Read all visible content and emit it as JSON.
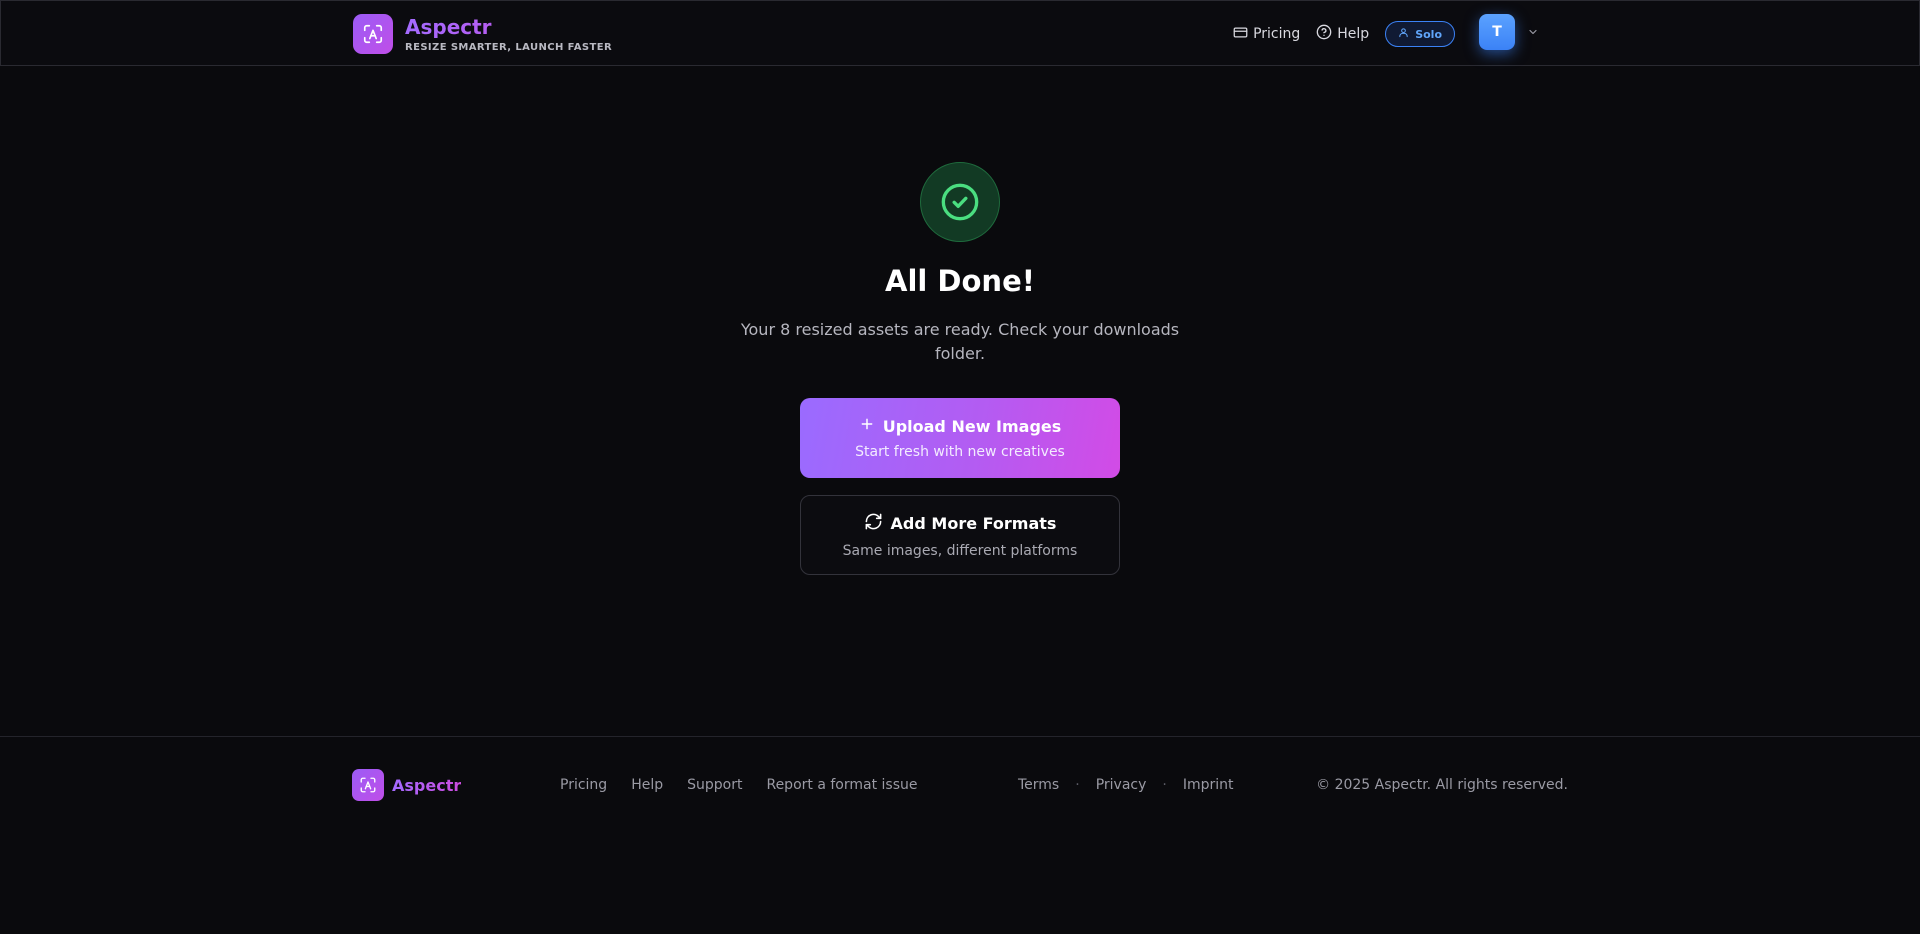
{
  "header": {
    "brand_name": "Aspectr",
    "tagline": "RESIZE SMARTER, LAUNCH FASTER",
    "nav": {
      "pricing": "Pricing",
      "help": "Help"
    },
    "plan_badge": "Solo",
    "avatar_initial": "T"
  },
  "main": {
    "title": "All Done!",
    "subtitle": "Your 8 resized assets are ready. Check your downloads folder.",
    "upload_button": {
      "label": "Upload New Images",
      "sublabel": "Start fresh with new creatives"
    },
    "formats_button": {
      "label": "Add More Formats",
      "sublabel": "Same images, different platforms"
    }
  },
  "footer": {
    "brand_name": "Aspectr",
    "links": {
      "pricing": "Pricing",
      "help": "Help",
      "support": "Support",
      "report": "Report a format issue"
    },
    "legal": {
      "terms": "Terms",
      "privacy": "Privacy",
      "imprint": "Imprint",
      "separator": "·"
    },
    "copyright": "© 2025 Aspectr. All rights reserved."
  },
  "colors": {
    "background": "#0a0a0d",
    "accent_purple": "#9b5cf6",
    "accent_pink": "#d24be6",
    "success_green": "#4ade80",
    "plan_blue": "#3b82f6"
  },
  "icons": [
    "aspectr-logo-icon",
    "credit-card-icon",
    "help-circle-icon",
    "user-icon",
    "chevron-down-icon",
    "check-circle-icon",
    "plus-icon",
    "refresh-icon"
  ]
}
